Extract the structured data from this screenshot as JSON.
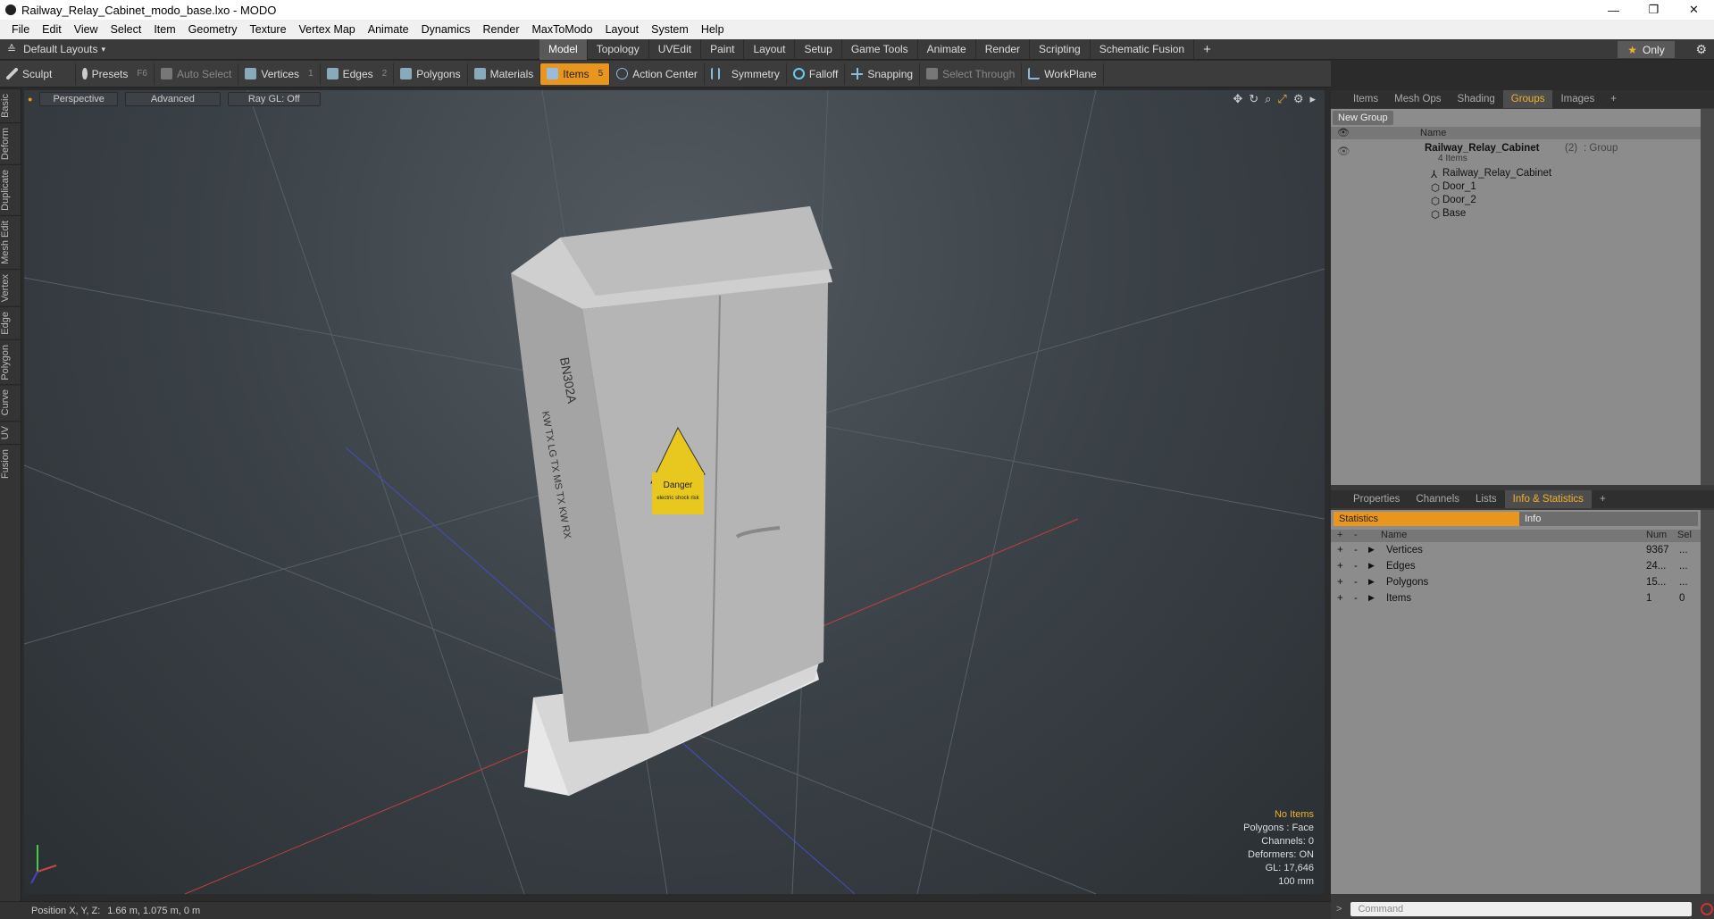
{
  "window": {
    "title": "Railway_Relay_Cabinet_modo_base.lxo - MODO",
    "minimize": "—",
    "maximize": "❐",
    "close": "✕"
  },
  "menu": [
    "File",
    "Edit",
    "View",
    "Select",
    "Item",
    "Geometry",
    "Texture",
    "Vertex Map",
    "Animate",
    "Dynamics",
    "Render",
    "MaxToModo",
    "Layout",
    "System",
    "Help"
  ],
  "layout": {
    "name": "Default Layouts",
    "arrow": "▾",
    "only_label": "Only",
    "only_star": "★",
    "plus": "+",
    "gear": "⚙"
  },
  "mode_tabs": [
    "Model",
    "Topology",
    "UVEdit",
    "Paint",
    "Layout",
    "Setup",
    "Game Tools",
    "Animate",
    "Render",
    "Scripting",
    "Schematic Fusion"
  ],
  "toolbar": {
    "sculpt": "Sculpt",
    "presets": "Presets",
    "presets_key": "F6",
    "auto_select": "Auto Select",
    "vertices": "Vertices",
    "vertices_key": "1",
    "edges": "Edges",
    "edges_key": "2",
    "polygons": "Polygons",
    "materials": "Materials",
    "items": "Items",
    "items_key": "5",
    "action_center": "Action Center",
    "symmetry": "Symmetry",
    "falloff": "Falloff",
    "snapping": "Snapping",
    "select_through": "Select Through",
    "workplane": "WorkPlane"
  },
  "left_tabs": [
    "Basic",
    "Deform",
    "Duplicate",
    "Mesh Edit",
    "Vertex",
    "Edge",
    "Polygon",
    "Curve",
    "UV",
    "Fusion"
  ],
  "viewport": {
    "view_mode": "Perspective",
    "shading": "Advanced",
    "raygl": "Ray GL: Off",
    "info": [
      "No Items",
      "Polygons : Face",
      "Channels: 0",
      "Deformers: ON",
      "GL: 17,646",
      "100 mm"
    ],
    "cabinet_text": {
      "code": "BN302A",
      "lines": "KW TX LG TX MS TX KW RX",
      "sign": "Danger",
      "sign_sub": "electric shock risk"
    }
  },
  "status": {
    "label": "Position X, Y, Z:",
    "value": "1.66 m, 1.075 m, 0 m"
  },
  "top_panel": {
    "tabs": [
      "Items",
      "Mesh Ops",
      "Shading",
      "Groups",
      "Images"
    ],
    "active_tab": "Groups",
    "plus": "+",
    "new_group": "New Group",
    "name_header": "Name",
    "group": {
      "name": "Railway_Relay_Cabinet",
      "count": "(2)",
      "type": ": Group",
      "sub": "4 Items"
    },
    "items": [
      "Railway_Relay_Cabinet",
      "Door_1",
      "Door_2",
      "Base"
    ]
  },
  "bottom_panel": {
    "tabs": [
      "Properties",
      "Channels",
      "Lists",
      "Info & Statistics"
    ],
    "active_tab": "Info & Statistics",
    "plus": "+",
    "statistics_tab": "Statistics",
    "info_tab": "Info",
    "headers": {
      "plus": "+",
      "minus": "-",
      "name": "Name",
      "num": "Num",
      "sel": "Sel"
    },
    "rows": [
      {
        "name": "Vertices",
        "num": "9367",
        "sel": "..."
      },
      {
        "name": "Edges",
        "num": "24...",
        "sel": "..."
      },
      {
        "name": "Polygons",
        "num": "15...",
        "sel": "..."
      },
      {
        "name": "Items",
        "num": "1",
        "sel": "0"
      }
    ]
  },
  "command": {
    "prompt": ">",
    "placeholder": "Command"
  }
}
